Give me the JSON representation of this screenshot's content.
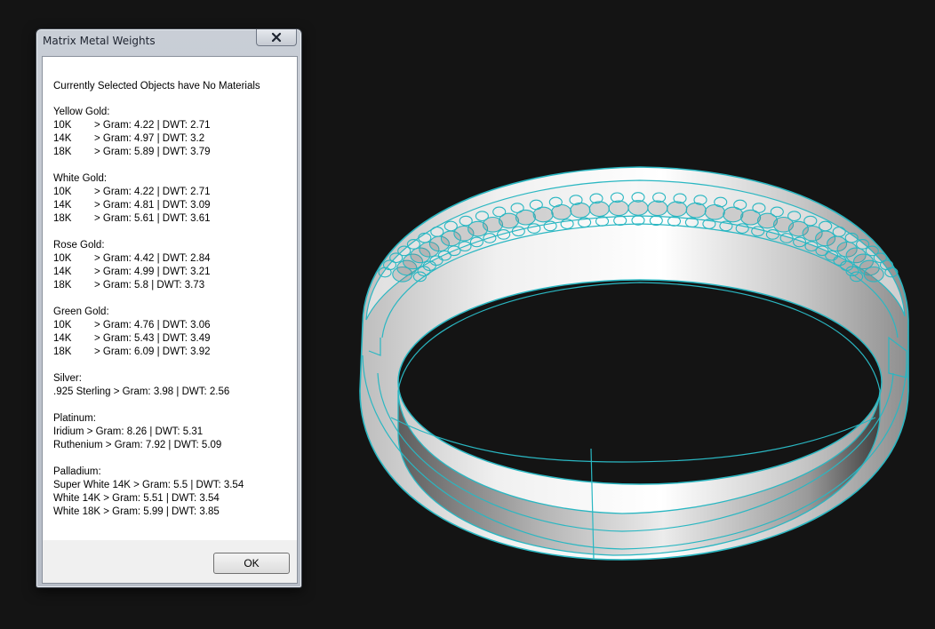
{
  "dialog": {
    "title": "Matrix Metal Weights",
    "close_label": "✕",
    "message": "Currently Selected Objects have No Materials",
    "ok_label": "OK"
  },
  "groups": [
    {
      "label": "Yellow Gold:",
      "rows": [
        {
          "karat": "10K",
          "text": "> Gram: 4.22 | DWT: 2.71"
        },
        {
          "karat": "14K",
          "text": "> Gram: 4.97 | DWT: 3.2"
        },
        {
          "karat": "18K",
          "text": "> Gram: 5.89 | DWT: 3.79"
        }
      ]
    },
    {
      "label": "White Gold:",
      "rows": [
        {
          "karat": "10K",
          "text": "> Gram: 4.22 | DWT: 2.71"
        },
        {
          "karat": "14K",
          "text": "> Gram: 4.81 | DWT: 3.09"
        },
        {
          "karat": "18K",
          "text": "> Gram: 5.61 | DWT: 3.61"
        }
      ]
    },
    {
      "label": "Rose Gold:",
      "rows": [
        {
          "karat": "10K",
          "text": "> Gram: 4.42 | DWT: 2.84"
        },
        {
          "karat": "14K",
          "text": "> Gram: 4.99 | DWT: 3.21"
        },
        {
          "karat": "18K",
          "text": "> Gram: 5.8 | DWT: 3.73"
        }
      ]
    },
    {
      "label": "Green Gold:",
      "rows": [
        {
          "karat": "10K",
          "text": "> Gram: 4.76 | DWT: 3.06"
        },
        {
          "karat": "14K",
          "text": "> Gram: 5.43 | DWT: 3.49"
        },
        {
          "karat": "18K",
          "text": "> Gram: 6.09 | DWT: 3.92"
        }
      ]
    },
    {
      "label": "Silver:",
      "rows": [
        {
          "karat": "",
          "text": ".925 Sterling > Gram: 3.98 | DWT: 2.56"
        }
      ]
    },
    {
      "label": "Platinum:",
      "rows": [
        {
          "karat": "",
          "text": "Iridium > Gram: 8.26 | DWT: 5.31"
        },
        {
          "karat": "",
          "text": "Ruthenium > Gram: 7.92 | DWT: 5.09"
        }
      ]
    },
    {
      "label": "Palladium:",
      "rows": [
        {
          "karat": "",
          "text": "Super White 14K > Gram: 5.5 | DWT: 3.54"
        },
        {
          "karat": "",
          "text": "White 14K > Gram: 5.51 | DWT: 3.54"
        },
        {
          "karat": "",
          "text": "White 18K > Gram: 5.99 | DWT: 3.85"
        }
      ]
    }
  ],
  "viewport": {
    "background": "#141414",
    "wire_color": "#2ab7c2",
    "metal_light": "#f2f2f2",
    "metal_dark": "#7c7c7c"
  }
}
